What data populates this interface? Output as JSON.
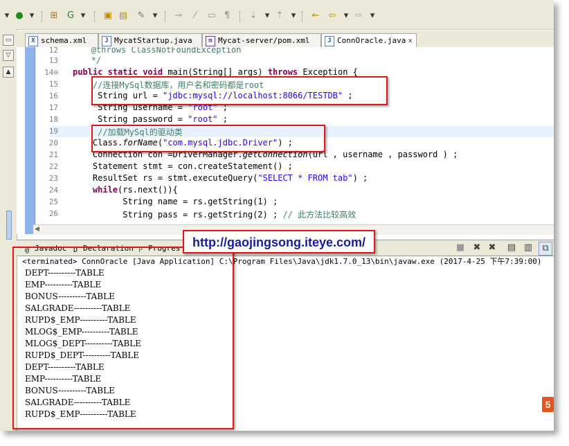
{
  "tabs": [
    {
      "label": "schema.xml",
      "icon": "X"
    },
    {
      "label": "MycatStartup.java",
      "icon": "J"
    },
    {
      "label": "Mycat-server/pom.xml",
      "icon": "m"
    },
    {
      "label": "ConnOracle.java",
      "icon": "J",
      "active": true
    }
  ],
  "editor": {
    "lines": [
      {
        "no": "12",
        "text": "   @throws ClassNotFoundException"
      },
      {
        "no": "13",
        "text": "   */"
      },
      {
        "no": "14⊖",
        "text": "public static void main(String[] args) throws Exception {"
      },
      {
        "no": "15",
        "text": "    //连接MySql数据库，用户名和密码都是root"
      },
      {
        "no": "16",
        "text": "     String url = \"jdbc:mysql://localhost:8066/TESTDB\" ;"
      },
      {
        "no": "17",
        "text": "     String username = \"root\" ;"
      },
      {
        "no": "18",
        "text": "     String password = \"root\" ;"
      },
      {
        "no": "19",
        "text": "     //加载MySql的驱动类"
      },
      {
        "no": "20",
        "text": "    Class.forName(\"com.mysql.jdbc.Driver\") ;"
      },
      {
        "no": "21",
        "text": "    Connection con =DriverManager.getConnection(url , username , password ) ;"
      },
      {
        "no": "22",
        "text": "    Statement stmt = con.createStatement() ;"
      },
      {
        "no": "23",
        "text": "    ResultSet rs = stmt.executeQuery(\"SELECT * FROM tab\") ;"
      },
      {
        "no": "24",
        "text": "    while(rs.next()){"
      },
      {
        "no": "25",
        "text": "          String name = rs.getString(1) ;"
      },
      {
        "no": "26",
        "text": "          String pass = rs.getString(2) ; // 此方法比较高效"
      }
    ]
  },
  "bottom_tabs": [
    {
      "label": "Javadoc",
      "icon": "@"
    },
    {
      "label": "Declaration",
      "icon": "D"
    },
    {
      "label": "Progres",
      "icon": "P"
    }
  ],
  "console": {
    "header": "<terminated> ConnOracle [Java Application] C:\\Program Files\\Java\\jdk1.7.0_13\\bin\\javaw.exe (2017-4-25 下午7:39:00)",
    "lines": [
      "DEPT----------TABLE",
      "EMP----------TABLE",
      "BONUS----------TABLE",
      "SALGRADE----------TABLE",
      "RUPD$_EMP----------TABLE",
      "MLOG$_EMP----------TABLE",
      "MLOG$_DEPT----------TABLE",
      "RUPD$_DEPT----------TABLE",
      "DEPT----------TABLE",
      "EMP----------TABLE",
      "BONUS----------TABLE",
      "SALGRADE----------TABLE",
      "RUPD$_EMP----------TABLE"
    ]
  },
  "watermark_url": "http://gaojingsong.iteye.com/",
  "colors": {
    "annotation_red": "#e01818",
    "keyword": "#7f0055",
    "comment": "#3f7f5f",
    "string": "#2a00ff"
  },
  "icons": [
    "debug-icon",
    "run-icon",
    "new-package-icon",
    "open-type-icon",
    "search-icon",
    "back-icon",
    "forward-icon"
  ]
}
